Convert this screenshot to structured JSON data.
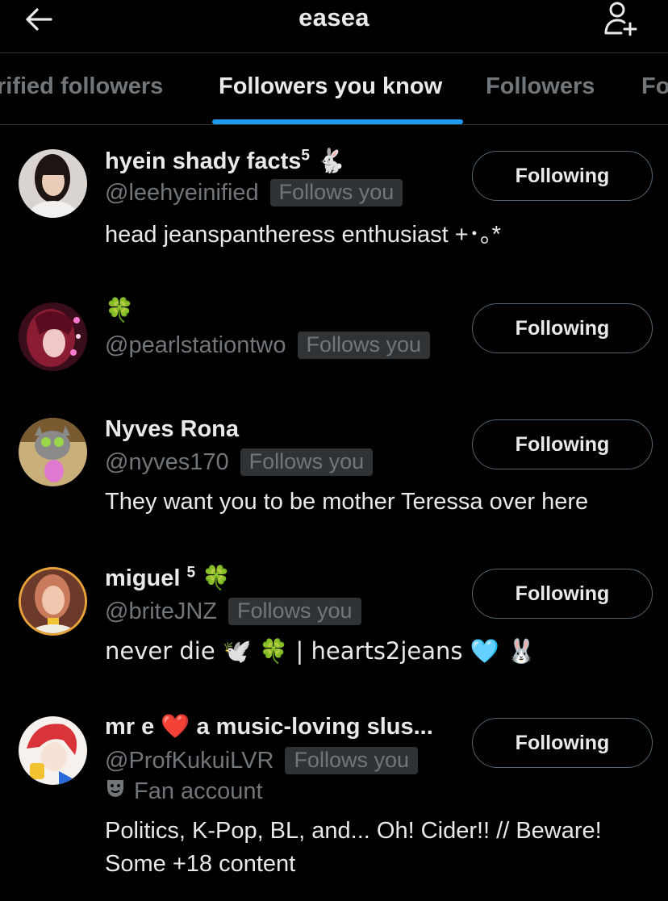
{
  "header": {
    "title": "easea"
  },
  "tabs": [
    {
      "label": "rified followers"
    },
    {
      "label": "Followers you know"
    },
    {
      "label": "Followers"
    },
    {
      "label": "Fo"
    }
  ],
  "users": [
    {
      "name": "hyein shady facts",
      "name_sup": "5",
      "name_emoji": "🐇",
      "handle": "@leehyeinified",
      "badge": "Follows you",
      "bio": "head jeanspantheress enthusiast +･｡*",
      "button": "Following"
    },
    {
      "name": "🍀",
      "handle": "@pearlstationtwo",
      "badge": "Follows you",
      "button": "Following"
    },
    {
      "name": "Nyves Rona",
      "handle": "@nyves170",
      "badge": "Follows you",
      "bio": "They want you to be mother Teressa over here",
      "button": "Following"
    },
    {
      "name": "miguel",
      "name_sup": "5",
      "name_emoji": "🍀",
      "handle": "@briteJNZ",
      "badge": "Follows you",
      "bio": "never die 🕊️ 🍀 | hearts2jeans 🩵 🐰",
      "button": "Following"
    },
    {
      "name": "mr e ❤️ a music-loving slus...",
      "handle": "@ProfKukuiLVR",
      "badge": "Follows you",
      "label": "Fan account",
      "bio_line1": "Politics, K-Pop, BL, and... Oh! Cider!! // Beware!",
      "bio_line2": "Some +18 content",
      "button": "Following"
    }
  ]
}
